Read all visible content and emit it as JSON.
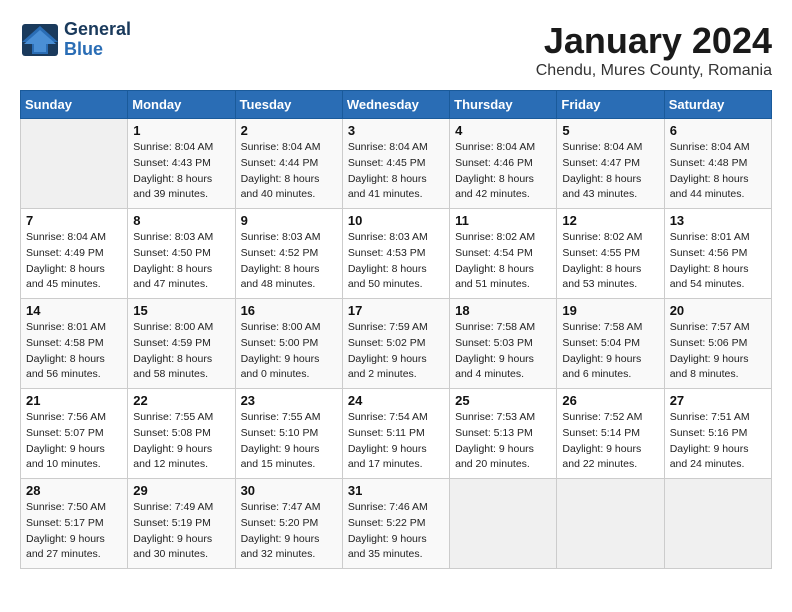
{
  "logo": {
    "line1": "General",
    "line2": "Blue"
  },
  "title": "January 2024",
  "subtitle": "Chendu, Mures County, Romania",
  "days_of_week": [
    "Sunday",
    "Monday",
    "Tuesday",
    "Wednesday",
    "Thursday",
    "Friday",
    "Saturday"
  ],
  "weeks": [
    [
      {
        "day": "",
        "info": ""
      },
      {
        "day": "1",
        "info": "Sunrise: 8:04 AM\nSunset: 4:43 PM\nDaylight: 8 hours\nand 39 minutes."
      },
      {
        "day": "2",
        "info": "Sunrise: 8:04 AM\nSunset: 4:44 PM\nDaylight: 8 hours\nand 40 minutes."
      },
      {
        "day": "3",
        "info": "Sunrise: 8:04 AM\nSunset: 4:45 PM\nDaylight: 8 hours\nand 41 minutes."
      },
      {
        "day": "4",
        "info": "Sunrise: 8:04 AM\nSunset: 4:46 PM\nDaylight: 8 hours\nand 42 minutes."
      },
      {
        "day": "5",
        "info": "Sunrise: 8:04 AM\nSunset: 4:47 PM\nDaylight: 8 hours\nand 43 minutes."
      },
      {
        "day": "6",
        "info": "Sunrise: 8:04 AM\nSunset: 4:48 PM\nDaylight: 8 hours\nand 44 minutes."
      }
    ],
    [
      {
        "day": "7",
        "info": "Sunrise: 8:04 AM\nSunset: 4:49 PM\nDaylight: 8 hours\nand 45 minutes."
      },
      {
        "day": "8",
        "info": "Sunrise: 8:03 AM\nSunset: 4:50 PM\nDaylight: 8 hours\nand 47 minutes."
      },
      {
        "day": "9",
        "info": "Sunrise: 8:03 AM\nSunset: 4:52 PM\nDaylight: 8 hours\nand 48 minutes."
      },
      {
        "day": "10",
        "info": "Sunrise: 8:03 AM\nSunset: 4:53 PM\nDaylight: 8 hours\nand 50 minutes."
      },
      {
        "day": "11",
        "info": "Sunrise: 8:02 AM\nSunset: 4:54 PM\nDaylight: 8 hours\nand 51 minutes."
      },
      {
        "day": "12",
        "info": "Sunrise: 8:02 AM\nSunset: 4:55 PM\nDaylight: 8 hours\nand 53 minutes."
      },
      {
        "day": "13",
        "info": "Sunrise: 8:01 AM\nSunset: 4:56 PM\nDaylight: 8 hours\nand 54 minutes."
      }
    ],
    [
      {
        "day": "14",
        "info": "Sunrise: 8:01 AM\nSunset: 4:58 PM\nDaylight: 8 hours\nand 56 minutes."
      },
      {
        "day": "15",
        "info": "Sunrise: 8:00 AM\nSunset: 4:59 PM\nDaylight: 8 hours\nand 58 minutes."
      },
      {
        "day": "16",
        "info": "Sunrise: 8:00 AM\nSunset: 5:00 PM\nDaylight: 9 hours\nand 0 minutes."
      },
      {
        "day": "17",
        "info": "Sunrise: 7:59 AM\nSunset: 5:02 PM\nDaylight: 9 hours\nand 2 minutes."
      },
      {
        "day": "18",
        "info": "Sunrise: 7:58 AM\nSunset: 5:03 PM\nDaylight: 9 hours\nand 4 minutes."
      },
      {
        "day": "19",
        "info": "Sunrise: 7:58 AM\nSunset: 5:04 PM\nDaylight: 9 hours\nand 6 minutes."
      },
      {
        "day": "20",
        "info": "Sunrise: 7:57 AM\nSunset: 5:06 PM\nDaylight: 9 hours\nand 8 minutes."
      }
    ],
    [
      {
        "day": "21",
        "info": "Sunrise: 7:56 AM\nSunset: 5:07 PM\nDaylight: 9 hours\nand 10 minutes."
      },
      {
        "day": "22",
        "info": "Sunrise: 7:55 AM\nSunset: 5:08 PM\nDaylight: 9 hours\nand 12 minutes."
      },
      {
        "day": "23",
        "info": "Sunrise: 7:55 AM\nSunset: 5:10 PM\nDaylight: 9 hours\nand 15 minutes."
      },
      {
        "day": "24",
        "info": "Sunrise: 7:54 AM\nSunset: 5:11 PM\nDaylight: 9 hours\nand 17 minutes."
      },
      {
        "day": "25",
        "info": "Sunrise: 7:53 AM\nSunset: 5:13 PM\nDaylight: 9 hours\nand 20 minutes."
      },
      {
        "day": "26",
        "info": "Sunrise: 7:52 AM\nSunset: 5:14 PM\nDaylight: 9 hours\nand 22 minutes."
      },
      {
        "day": "27",
        "info": "Sunrise: 7:51 AM\nSunset: 5:16 PM\nDaylight: 9 hours\nand 24 minutes."
      }
    ],
    [
      {
        "day": "28",
        "info": "Sunrise: 7:50 AM\nSunset: 5:17 PM\nDaylight: 9 hours\nand 27 minutes."
      },
      {
        "day": "29",
        "info": "Sunrise: 7:49 AM\nSunset: 5:19 PM\nDaylight: 9 hours\nand 30 minutes."
      },
      {
        "day": "30",
        "info": "Sunrise: 7:47 AM\nSunset: 5:20 PM\nDaylight: 9 hours\nand 32 minutes."
      },
      {
        "day": "31",
        "info": "Sunrise: 7:46 AM\nSunset: 5:22 PM\nDaylight: 9 hours\nand 35 minutes."
      },
      {
        "day": "",
        "info": ""
      },
      {
        "day": "",
        "info": ""
      },
      {
        "day": "",
        "info": ""
      }
    ]
  ]
}
